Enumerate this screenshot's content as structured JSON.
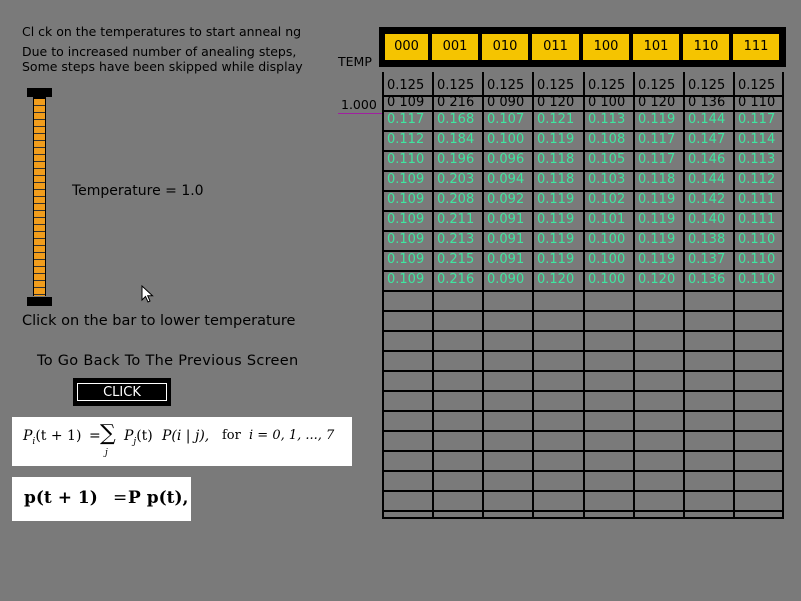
{
  "instructions": {
    "line1": "Cl ck on the temperatures to start anneal ng",
    "line2": "Due to increased number of anealing steps,",
    "line3": "Some steps have been skipped while display"
  },
  "temperature_readout": "Temperature = 1.0",
  "bar_instruction": "Click on the bar to lower temperature",
  "back_label": "To Go Back To The Previous Screen",
  "click_button": "CLICK",
  "temp_heading": "TEMP",
  "temp_value": "1.000",
  "header_cells": [
    "000",
    "001",
    "010",
    "011",
    "100",
    "101",
    "110",
    "111"
  ],
  "initial_row": [
    "0.125",
    "0.125",
    "0.125",
    "0.125",
    "0.125",
    "0.125",
    "0.125",
    "0.125"
  ],
  "first_row": [
    "0 109",
    "0 216",
    "0 090",
    "0 120",
    "0 100",
    "0 120",
    "0 136",
    "0 110"
  ],
  "green_rows": [
    [
      "0.117",
      "0.168",
      "0.107",
      "0.121",
      "0.113",
      "0.119",
      "0.144",
      "0.117"
    ],
    [
      "0.112",
      "0.184",
      "0.100",
      "0.119",
      "0.108",
      "0.117",
      "0.147",
      "0.114"
    ],
    [
      "0.110",
      "0.196",
      "0.096",
      "0.118",
      "0.105",
      "0.117",
      "0.146",
      "0.113"
    ],
    [
      "0.109",
      "0.203",
      "0.094",
      "0.118",
      "0.103",
      "0.118",
      "0.144",
      "0.112"
    ],
    [
      "0.109",
      "0.208",
      "0.092",
      "0.119",
      "0.102",
      "0.119",
      "0.142",
      "0.111"
    ],
    [
      "0.109",
      "0.211",
      "0.091",
      "0.119",
      "0.101",
      "0.119",
      "0.140",
      "0.111"
    ],
    [
      "0.109",
      "0.213",
      "0.091",
      "0.119",
      "0.100",
      "0.119",
      "0.138",
      "0.110"
    ],
    [
      "0.109",
      "0.215",
      "0.091",
      "0.119",
      "0.100",
      "0.119",
      "0.137",
      "0.110"
    ],
    [
      "0.109",
      "0.216",
      "0.090",
      "0.120",
      "0.100",
      "0.120",
      "0.136",
      "0.110"
    ]
  ],
  "formula1": {
    "lhs": "P",
    "lhs_sub": "i",
    "lhs_arg": "(t + 1)",
    "eq": "=",
    "sum": "∑",
    "sum_sub": "j",
    "term1": "P",
    "term1_sub": "j",
    "term1_arg": "(t)",
    "term2": "P(i | j),",
    "for_text": "for",
    "index_text": "i = 0, 1, ..., 7"
  },
  "formula2": {
    "lhs": "p(t + 1)",
    "eq": "=",
    "rhs": "P p(t),"
  },
  "colors": {
    "background": "#7a7a7a",
    "header_fill": "#f5c400",
    "thermometer": "#f19d1c",
    "value_green": "#3fe6a0"
  }
}
